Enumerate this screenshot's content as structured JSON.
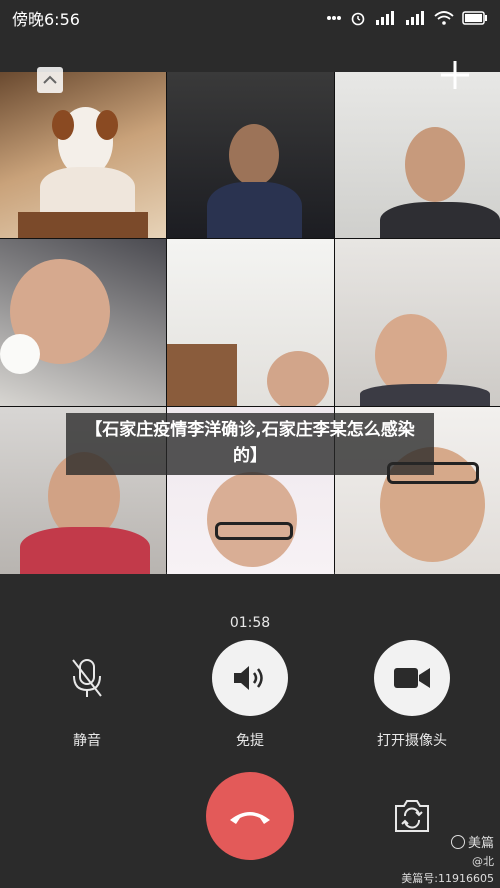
{
  "status_bar": {
    "time": "傍晚6:56"
  },
  "call": {
    "caption": "【石家庄疫情李洋确诊,石家庄李某怎么感染的】",
    "timer": "01:58",
    "controls": {
      "mute_label": "静音",
      "speaker_label": "免提",
      "camera_label": "打开摄像头"
    }
  },
  "watermark": {
    "brand": "美篇",
    "handle": "@北",
    "id_text": "美篇号:11916605"
  },
  "colors": {
    "background": "#2b2b2b",
    "hangup": "#e35a59",
    "control_circle": "#f2f2f2"
  },
  "icons": [
    "chevron-up-icon",
    "plus-icon",
    "microphone-off-icon",
    "speaker-icon",
    "video-camera-icon",
    "phone-hangup-icon",
    "switch-camera-icon"
  ]
}
